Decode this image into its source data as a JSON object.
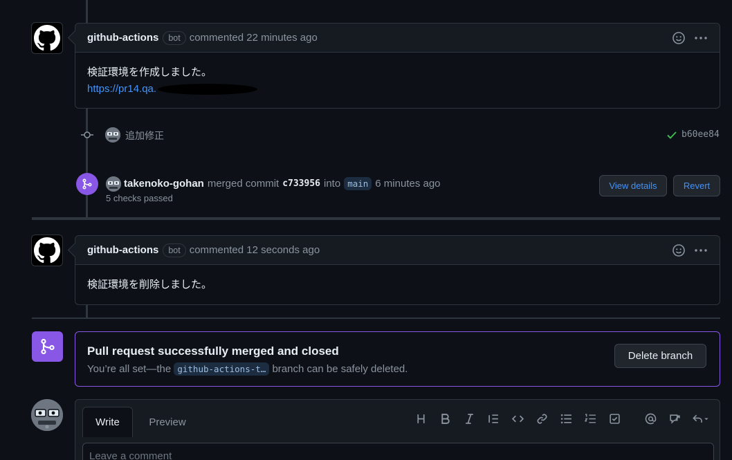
{
  "comment1": {
    "author": "github-actions",
    "badge": "bot",
    "meta": "commented 22 minutes ago",
    "body_line1": "検証環境を作成しました。",
    "link": "https://pr14.qa."
  },
  "commit": {
    "message": "追加修正",
    "sha": "b60ee84"
  },
  "merge_event": {
    "user": "takenoko-gohan",
    "merged_text": "merged commit",
    "commit_sha": "c733956",
    "into_text": "into",
    "branch": "main",
    "time": "6 minutes ago",
    "checks": "5 checks passed",
    "view_details": "View details",
    "revert": "Revert"
  },
  "comment2": {
    "author": "github-actions",
    "badge": "bot",
    "meta": "commented 12 seconds ago",
    "body_line1": "検証環境を削除しました。"
  },
  "merged_box": {
    "title": "Pull request successfully merged and closed",
    "sub_prefix": "You’re all set—the",
    "branch": "github-actions-t…",
    "sub_suffix": "branch can be safely deleted.",
    "delete_button": "Delete branch"
  },
  "editor": {
    "tab_write": "Write",
    "tab_preview": "Preview",
    "placeholder": "Leave a comment",
    "toolbar_icons": [
      "heading-icon",
      "bold-icon",
      "italic-icon",
      "quote-icon",
      "code-icon",
      "link-icon",
      "unordered-list-icon",
      "ordered-list-icon",
      "task-list-icon",
      "mention-icon",
      "reference-icon",
      "reply-icon"
    ]
  },
  "colors": {
    "background": "#0d1117",
    "merged_purple": "#8957e5",
    "link_blue": "#4493f8",
    "success_green": "#3fb950"
  }
}
